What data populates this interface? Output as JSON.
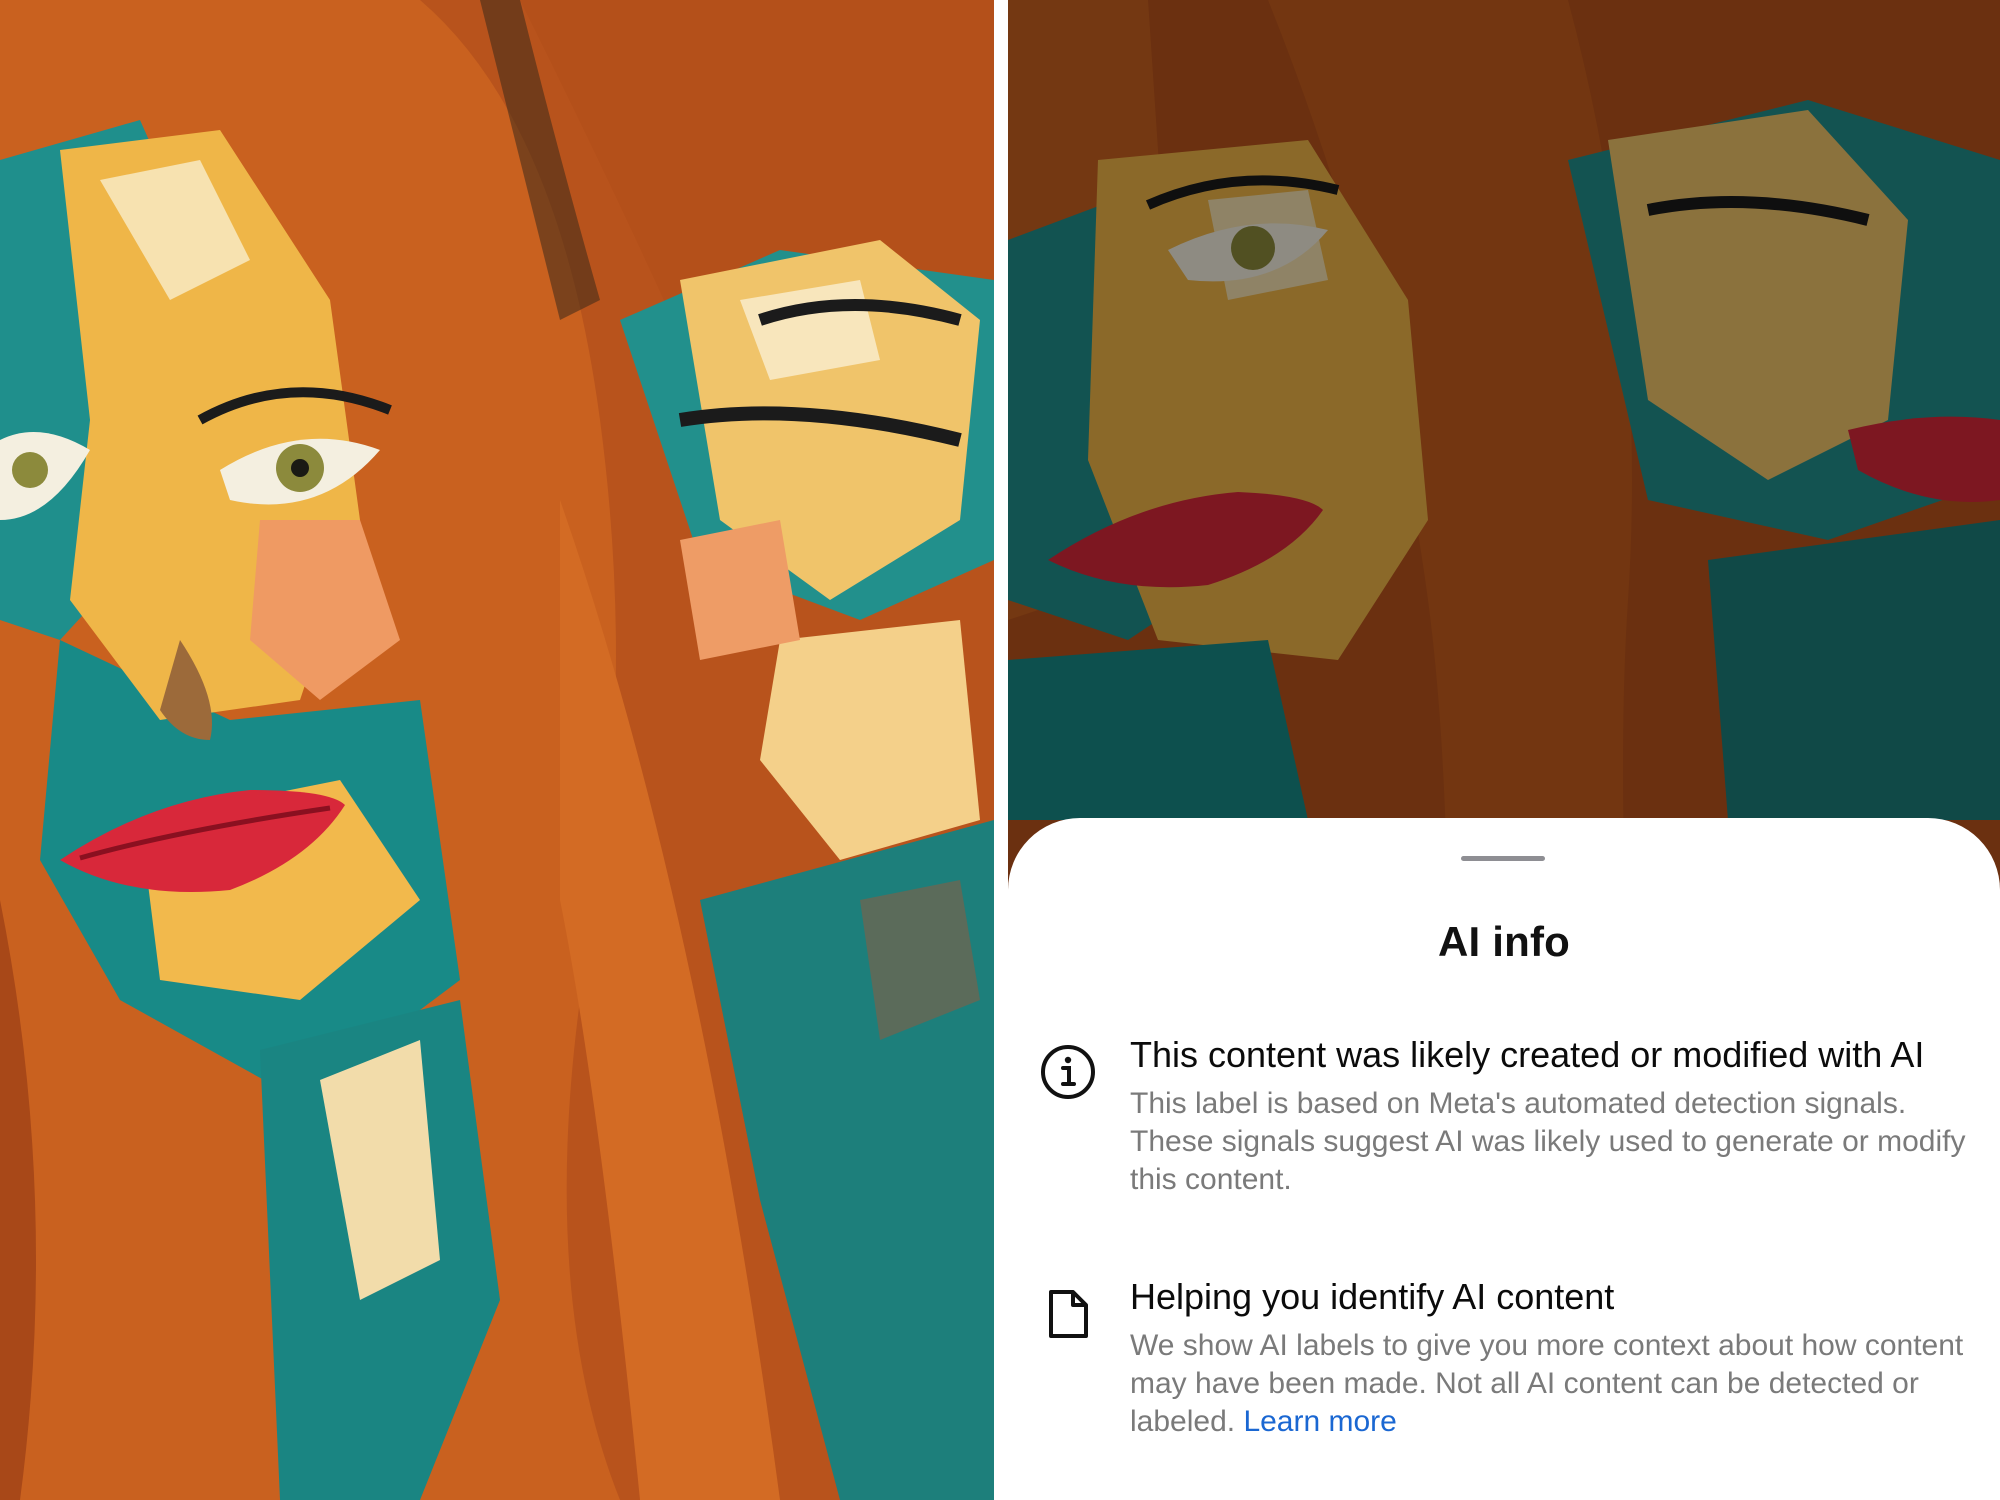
{
  "sheet": {
    "title": "AI info",
    "sections": [
      {
        "icon": "info-icon",
        "heading": "This content was likely created or modified with AI",
        "body": "This label is based on Meta's automated detection signals. These signals suggest AI was likely used to generate or modify this content."
      },
      {
        "icon": "document-icon",
        "heading": "Helping you identify AI content",
        "body": "We show AI labels to give you more context about how content may have been made. Not all AI content can be detected or labeled.",
        "link_label": "Learn more"
      }
    ]
  },
  "colors": {
    "link": "#1a67d2",
    "heading": "#0b0b0b",
    "body_text": "#7a7a7a",
    "sheet_background": "#ffffff"
  }
}
